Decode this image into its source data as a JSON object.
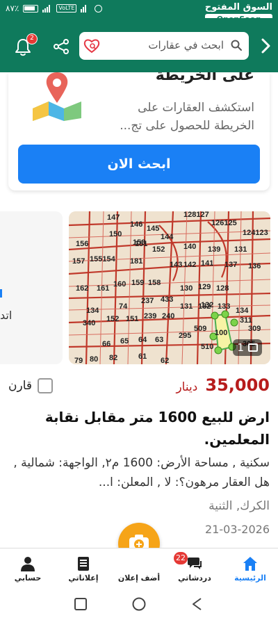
{
  "status": {
    "battery": "٨٧٪"
  },
  "brand": {
    "arabic": "السوق المفتوح",
    "english": "OpenSooq"
  },
  "header": {
    "search_placeholder": "ابحث في عقارات",
    "notification_count": "2"
  },
  "map_promo": {
    "title": "على الخريطة",
    "description": "استكشف العقارات على الخريطة للحصول على تج...",
    "button_label": "ابحث الان"
  },
  "listing": {
    "image_count": "1",
    "side_peek_text": "اتد",
    "price_amount": "35,000",
    "price_currency": "دينار",
    "compare_label": "قارن",
    "title": "ارض للبيع 1600 متر مقابل نقابة المعلمين.",
    "description": "سكنية , مساحة الأرض: 1600 م٢, الواجهة: شمالية , هل العقار مرهون؟: لا , المعلن: ا...",
    "location": "الكرك, الثنية",
    "date": "21-03-2026",
    "map_labels": [
      "147",
      "146",
      "145",
      "128127",
      "126125",
      "124123",
      "156",
      "150",
      "144",
      "158",
      "151",
      "152",
      "140",
      "139",
      "131",
      "157",
      "155154",
      "181",
      "143",
      "142",
      "141",
      "137",
      "136",
      "162",
      "161",
      "160",
      "159",
      "158",
      "130",
      "129",
      "128",
      "132",
      "134",
      "74",
      "237",
      "433",
      "131",
      "132",
      "133",
      "134",
      "340",
      "152",
      "151",
      "239",
      "240",
      "509",
      "100",
      "311",
      "309",
      "66",
      "65",
      "64",
      "63",
      "295",
      "510",
      "305",
      "79",
      "80",
      "82",
      "61",
      "62"
    ]
  },
  "nav": {
    "home": "الرئيسية",
    "chats": "دردشاتي",
    "chats_badge": "22",
    "add_ad": "أضف إعلان",
    "my_ads": "إعلاناتي",
    "account": "حسابي"
  },
  "colors": {
    "primary": "#0f7a5c",
    "accent": "#1a80f5",
    "price": "#b71c1c",
    "fab": "#f6a418"
  }
}
